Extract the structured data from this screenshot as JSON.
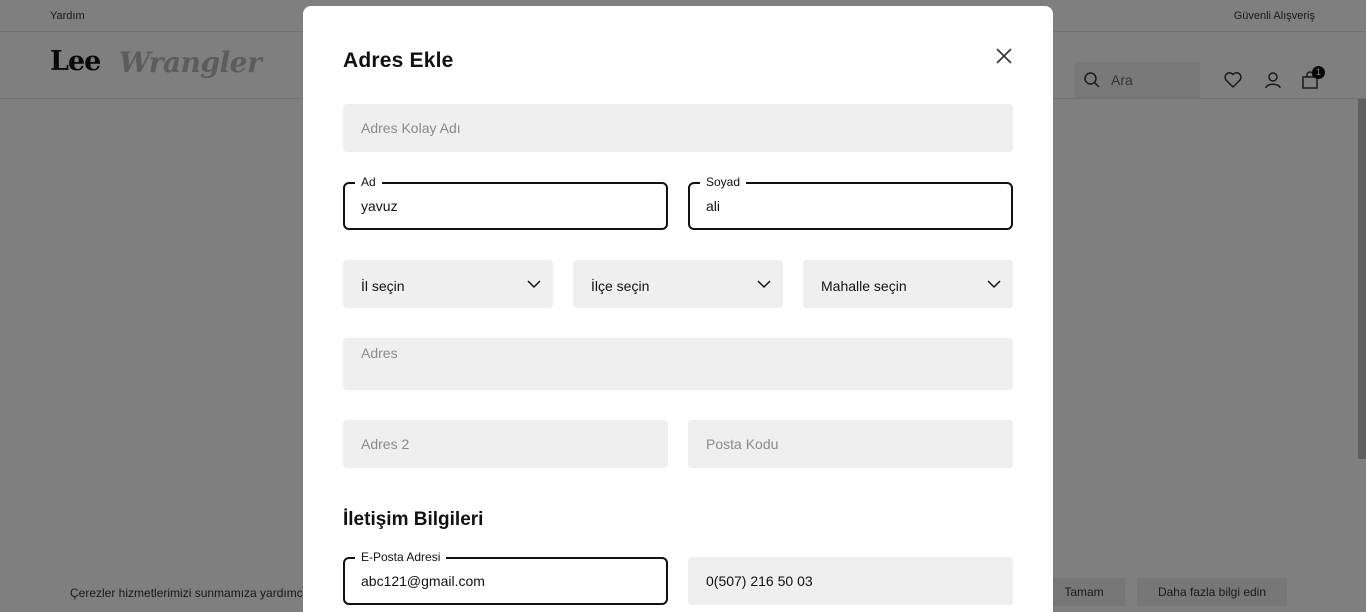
{
  "topbar": {
    "help": "Yardım",
    "secure": "Güvenli Alışveriş"
  },
  "header": {
    "brand_primary": "Lee",
    "brand_secondary": "Wrangler",
    "search_placeholder": "Ara",
    "cart_count": "1",
    "icons": [
      "search-icon",
      "heart-icon",
      "user-icon",
      "bag-icon"
    ]
  },
  "cookie": {
    "text": "Çerezler hizmetlerimizi sunmamıza yardımcı olur.",
    "ok": "Tamam",
    "more": "Daha fazla bilgi edin"
  },
  "modal": {
    "title": "Adres Ekle",
    "fields": {
      "address_nickname": {
        "placeholder": "Adres Kolay Adı"
      },
      "first_name": {
        "label": "Ad",
        "value": "yavuz"
      },
      "last_name": {
        "label": "Soyad",
        "value": "ali"
      },
      "city": {
        "label": "İl seçin"
      },
      "district": {
        "label": "İlçe seçin"
      },
      "neighborhood": {
        "label": "Mahalle seçin"
      },
      "address": {
        "placeholder": "Adres"
      },
      "address2": {
        "placeholder": "Adres 2"
      },
      "postal_code": {
        "placeholder": "Posta Kodu"
      },
      "email": {
        "label": "E-Posta Adresi",
        "value": "abc121@gmail.com"
      },
      "phone": {
        "value": "0(507) 216 50 03"
      }
    },
    "contact_section": "İletişim Bilgileri"
  },
  "colors": {
    "overlay": "rgba(0,0,0,0.5)",
    "field_bg": "#efefef",
    "active_border": "#111111"
  }
}
